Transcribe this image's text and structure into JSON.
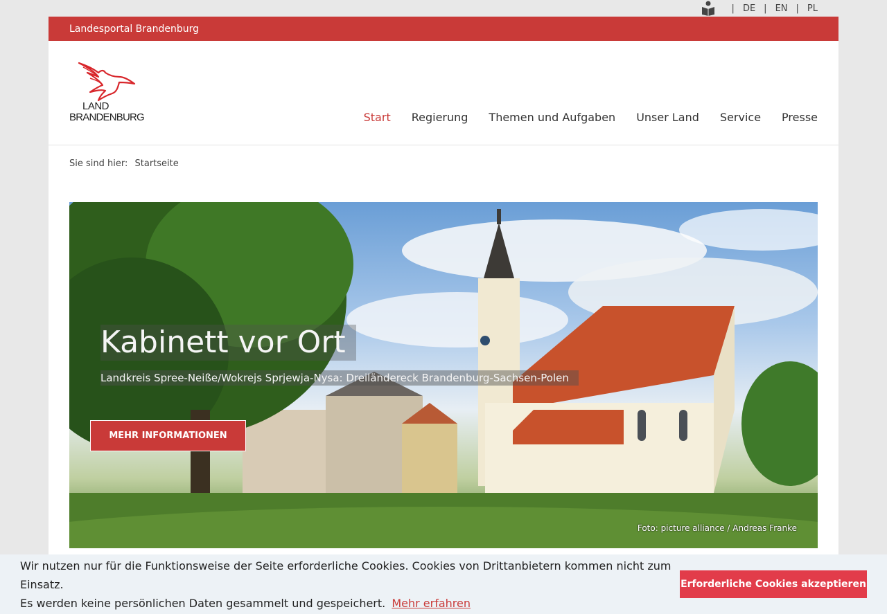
{
  "topbar": {
    "languages": [
      "DE",
      "EN",
      "PL"
    ],
    "easy_language_icon": "book-reader-icon"
  },
  "redbar": {
    "title": "Landesportal Brandenburg"
  },
  "logo": {
    "line1": "LAND",
    "line2": "BRANDENBURG",
    "icon": "red-eagle-icon"
  },
  "nav": {
    "items": [
      "Start",
      "Regierung",
      "Themen und Aufgaben",
      "Unser Land",
      "Service",
      "Presse"
    ],
    "active": "Start"
  },
  "breadcrumb": {
    "label": "Sie sind hier:",
    "current": "Startseite"
  },
  "hero": {
    "title": "Kabinett vor Ort",
    "subtitle": "Landkreis Spree-Neiße/Wokrejs Sprjewja-Nysa: Dreiländereck Brandenburg-Sachsen-Polen",
    "button": "MEHR INFORMATIONEN",
    "credit": "Foto: picture alliance / Andreas Franke"
  },
  "cookie": {
    "line1": "Wir nutzen nur für die Funktionsweise der Seite erforderliche Cookies. Cookies von Drittanbietern kommen nicht zum Einsatz.",
    "line2": "Es werden keine persönlichen Daten gesammelt und gespeichert.",
    "more": "Mehr erfahren",
    "accept": "Erforderliche Cookies akzeptieren"
  },
  "colors": {
    "brand_red": "#c93a38",
    "cookie_button": "#e23c4a",
    "cookie_bg": "#edf2f6"
  }
}
